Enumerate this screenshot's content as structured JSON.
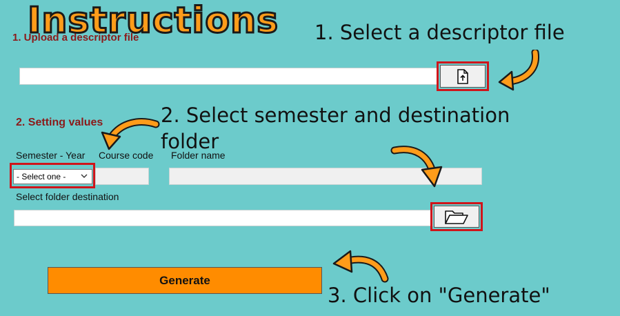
{
  "title": "Instructions",
  "section1": {
    "label": "1. Upload a descriptor file"
  },
  "section2": {
    "label": "2. Setting values"
  },
  "fields": {
    "semester_year_label": "Semester - Year",
    "course_code_label": "Course code",
    "folder_name_label": "Folder name",
    "folder_destination_label": "Select folder destination"
  },
  "semester_select": {
    "selected": "- Select one -"
  },
  "generate_button": {
    "label": "Generate"
  },
  "notes": {
    "step1": "1. Select a descriptor file",
    "step2": "2. Select semester and destination folder",
    "step3": "3. Click on \"Generate\""
  },
  "colors": {
    "background": "#6ccbcb",
    "section_label": "#8b1a1a",
    "highlight_frame": "#d0141a",
    "generate_button": "#ff8c00",
    "arrow": "#ff9c1a"
  },
  "icons": {
    "upload": "file-upload-icon",
    "folder": "folder-open-icon",
    "dropdown": "chevron-down-icon",
    "arrow": "curved-arrow-icon"
  }
}
